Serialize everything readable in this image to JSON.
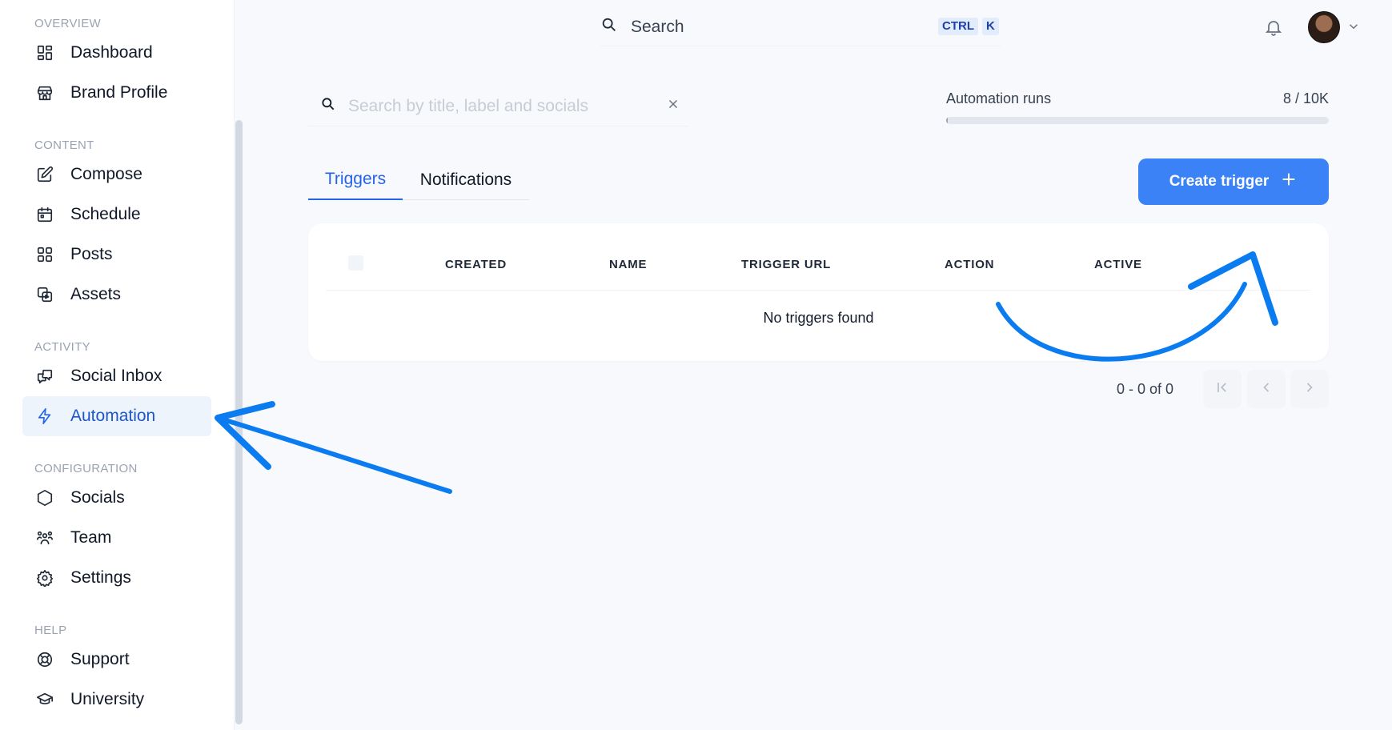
{
  "sidebar": {
    "sections": [
      {
        "label": "OVERVIEW"
      },
      {
        "label": "CONTENT"
      },
      {
        "label": "ACTIVITY"
      },
      {
        "label": "CONFIGURATION"
      },
      {
        "label": "HELP"
      }
    ],
    "items": [
      {
        "label": "Dashboard",
        "icon": "dashboard-icon"
      },
      {
        "label": "Brand Profile",
        "icon": "store-icon"
      },
      {
        "label": "Compose",
        "icon": "pencil-icon"
      },
      {
        "label": "Schedule",
        "icon": "calendar-icon"
      },
      {
        "label": "Posts",
        "icon": "grid-icon"
      },
      {
        "label": "Assets",
        "icon": "assets-icon"
      },
      {
        "label": "Social Inbox",
        "icon": "chat-icon"
      },
      {
        "label": "Automation",
        "icon": "lightning-icon",
        "active": true
      },
      {
        "label": "Socials",
        "icon": "hexagon-icon"
      },
      {
        "label": "Team",
        "icon": "team-icon"
      },
      {
        "label": "Settings",
        "icon": "gear-icon"
      },
      {
        "label": "Support",
        "icon": "lifebuoy-icon"
      },
      {
        "label": "University",
        "icon": "graduation-cap-icon"
      }
    ]
  },
  "topbar": {
    "search_label": "Search",
    "shortcut_ctrl": "CTRL",
    "shortcut_key": "K"
  },
  "filter": {
    "placeholder": "Search by title, label and socials"
  },
  "automation_runs": {
    "label": "Automation runs",
    "value": "8 / 10K",
    "used_fraction": 0.0008
  },
  "tabs": [
    {
      "label": "Triggers",
      "active": true
    },
    {
      "label": "Notifications",
      "active": false
    }
  ],
  "create_button": {
    "label": "Create trigger"
  },
  "table": {
    "columns": [
      "CREATED",
      "NAME",
      "TRIGGER URL",
      "ACTION",
      "ACTIVE"
    ],
    "empty_message": "No triggers found"
  },
  "pagination": {
    "range": "0 - 0 of 0"
  },
  "colors": {
    "accent": "#3b82f6",
    "active_nav_bg": "#eef4fc",
    "annotation_arrow": "#0a7cf0"
  }
}
